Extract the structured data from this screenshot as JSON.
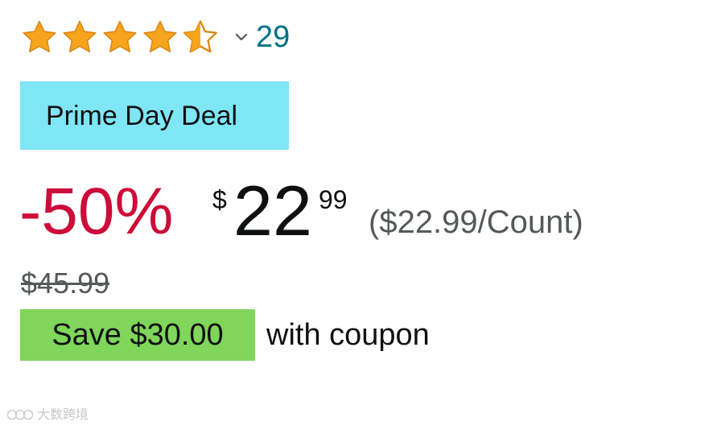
{
  "rating": {
    "stars": 4.5,
    "max_stars": 5,
    "star_color": "#f7a41d",
    "review_count": "29"
  },
  "deal_badge": {
    "label": "Prime Day Deal",
    "color": "#7fe6f6"
  },
  "price": {
    "discount": "-50%",
    "discount_color": "#cc0c39",
    "currency": "$",
    "whole": "22",
    "fraction": "99",
    "unit_price": "($22.99/Count)"
  },
  "list_price": "$45.99",
  "coupon": {
    "badge_label": "Save $30.00",
    "suffix": "with coupon",
    "badge_color": "#7fd65a"
  },
  "watermark": {
    "text": "大数跨境"
  },
  "icons": {
    "star": "star-icon",
    "half_star": "half-star-icon",
    "chevron": "chevron-down-icon",
    "watermark_logo": "watermark-logo-icon"
  }
}
